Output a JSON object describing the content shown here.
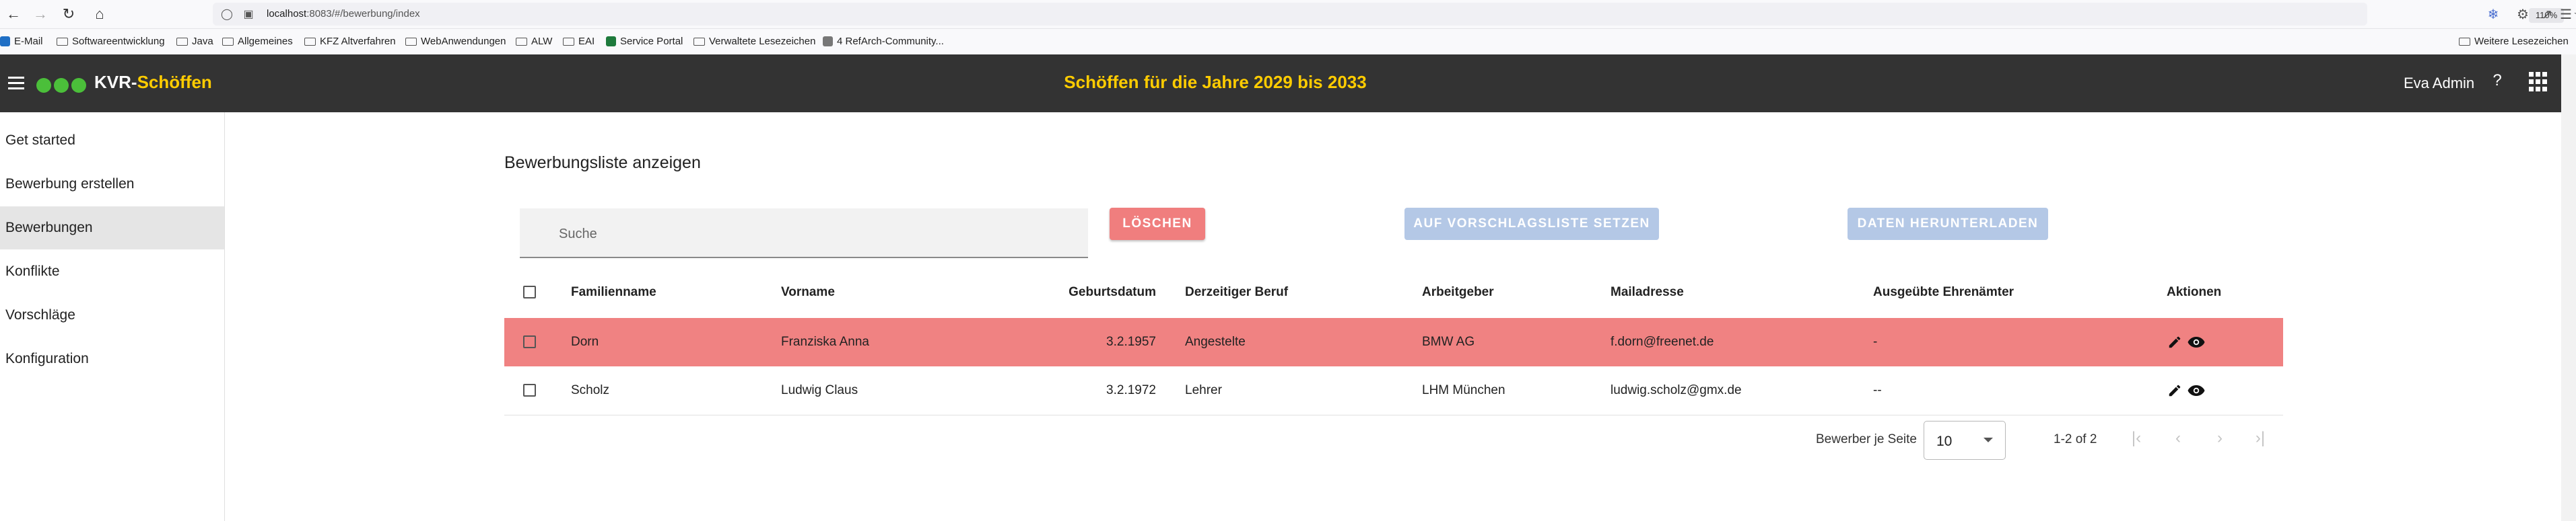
{
  "browser": {
    "url_prefix": "localhost",
    "url_rest": ":8083/#/bewerbung/index",
    "zoom": "110%",
    "bookmarks": [
      {
        "label": "E-Mail",
        "icon": "outlook-icon"
      },
      {
        "label": "Softwareentwicklung",
        "icon": "folder-icon"
      },
      {
        "label": "Java",
        "icon": "folder-icon"
      },
      {
        "label": "Allgemeines",
        "icon": "folder-icon"
      },
      {
        "label": "KFZ Altverfahren",
        "icon": "folder-icon"
      },
      {
        "label": "WebAnwendungen",
        "icon": "folder-icon"
      },
      {
        "label": "ALW",
        "icon": "folder-icon"
      },
      {
        "label": "EAI",
        "icon": "folder-icon"
      },
      {
        "label": "Service Portal",
        "icon": "service-icon"
      },
      {
        "label": "Verwaltete Lesezeichen",
        "icon": "folder-icon"
      },
      {
        "label": "4 RefArch-Community...",
        "icon": "page-icon"
      }
    ],
    "other_bookmarks": "Weitere Lesezeichen"
  },
  "app": {
    "logo_prefix": "KVR-",
    "logo_suffix": "Schöffen",
    "title": "Schöffen für die Jahre 2029 bis 2033",
    "user": "Eva Admin",
    "help": "?"
  },
  "sidebar": {
    "items": [
      {
        "label": "Get started",
        "active": false
      },
      {
        "label": "Bewerbung erstellen",
        "active": false
      },
      {
        "label": "Bewerbungen",
        "active": true
      },
      {
        "label": "Konflikte",
        "active": false
      },
      {
        "label": "Vorschläge",
        "active": false
      },
      {
        "label": "Konfiguration",
        "active": false
      }
    ]
  },
  "main": {
    "heading": "Bewerbungsliste anzeigen",
    "search_placeholder": "Suche",
    "delete_label": "LÖSCHEN",
    "proposal_label": "AUF VORSCHLAGSLISTE SETZEN",
    "download_label": "DATEN HERUNTERLADEN"
  },
  "table": {
    "headers": {
      "lastname": "Familienname",
      "firstname": "Vorname",
      "birthdate": "Geburtsdatum",
      "job": "Derzeitiger Beruf",
      "employer": "Arbeitgeber",
      "mail": "Mailadresse",
      "honorary": "Ausgeübte Ehrenämter",
      "actions": "Aktionen"
    },
    "rows": [
      {
        "lastname": "Dorn",
        "firstname": "Franziska Anna",
        "birthdate": "3.2.1957",
        "job": "Angestelte",
        "employer": "BMW AG",
        "mail": "f.dorn@freenet.de",
        "honorary": "-",
        "highlighted": true
      },
      {
        "lastname": "Scholz",
        "firstname": "Ludwig Claus",
        "birthdate": "3.2.1972",
        "job": "Lehrer",
        "employer": "LHM München",
        "mail": "ludwig.scholz@gmx.de",
        "honorary": "--",
        "highlighted": false
      }
    ]
  },
  "pagination": {
    "per_page_label": "Bewerber je Seite",
    "per_page_value": "10",
    "range": "1-2 of 2"
  },
  "colors": {
    "app_bar": "#333333",
    "accent": "#ffcc00",
    "logo_dots": "#4bbf3a",
    "delete_button": "#f07e7e",
    "highlight_row": "#f08282",
    "disabled_button": "#b4c8e6"
  }
}
